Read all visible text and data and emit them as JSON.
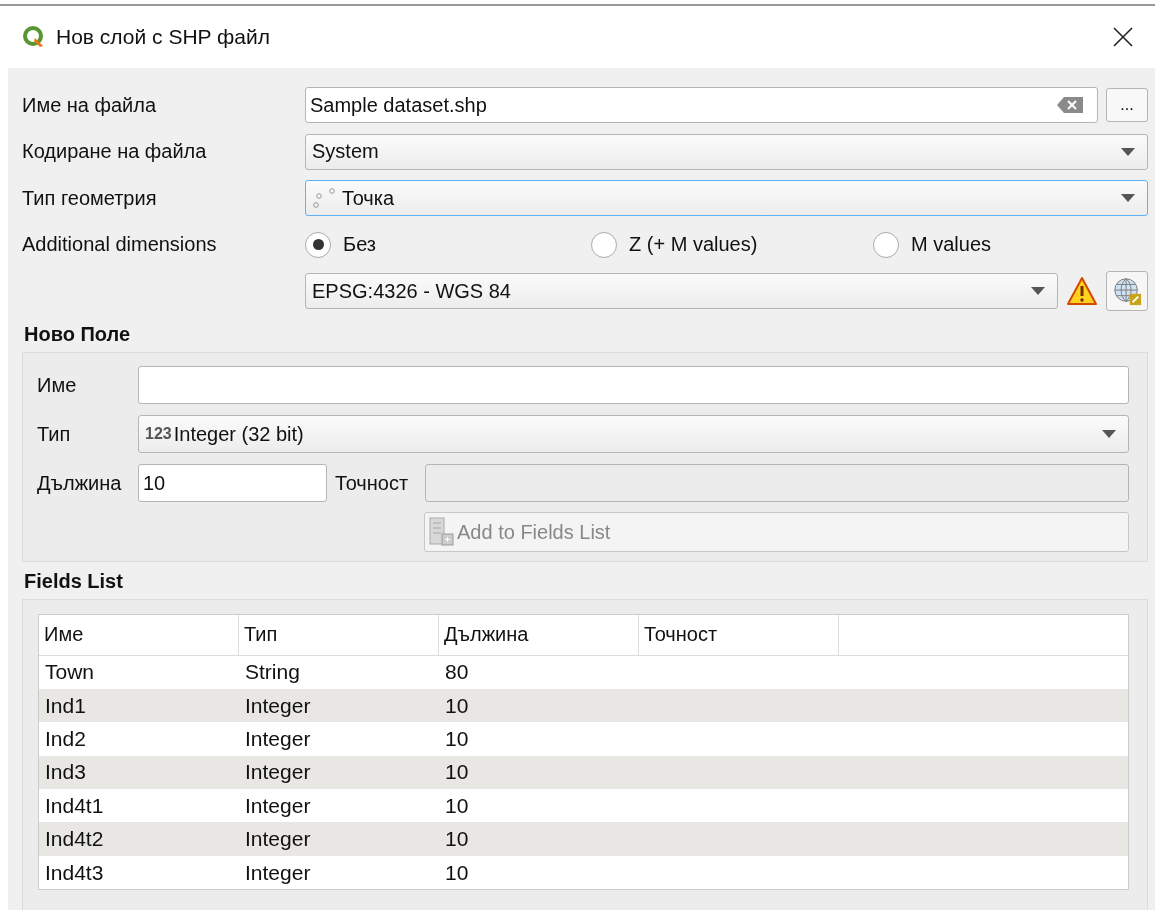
{
  "window": {
    "title": "Нов слой с SHP файл"
  },
  "file_name": {
    "label": "Име на файла",
    "value": "Sample dataset.shp",
    "browse": "..."
  },
  "file_encoding": {
    "label": "Кодиране на файла",
    "value": "System"
  },
  "geometry_type": {
    "label": "Тип геометрия",
    "value": "Точка",
    "focused": true
  },
  "dimensions": {
    "label": "Additional dimensions",
    "options": [
      {
        "label": "Без",
        "selected": true
      },
      {
        "label": "Z (+ M values)",
        "selected": false
      },
      {
        "label": "M values",
        "selected": false
      }
    ]
  },
  "crs": {
    "value": "EPSG:4326 - WGS 84"
  },
  "new_field": {
    "title": "Ново Поле",
    "name": {
      "label": "Име"
    },
    "type": {
      "label": "Тип",
      "badge": "123",
      "value": "Integer (32 bit)"
    },
    "length": {
      "label": "Дължина",
      "value": "10"
    },
    "precision": {
      "label": "Точност",
      "disabled": true
    },
    "add_button": {
      "label": "Add to Fields List",
      "disabled": true
    }
  },
  "fields_list": {
    "title": "Fields List",
    "columns": [
      "Име",
      "Тип",
      "Дължина",
      "Точност"
    ],
    "rows": [
      [
        "Town",
        "String",
        "80"
      ],
      [
        "Ind1",
        "Integer",
        "10"
      ],
      [
        "Ind2",
        "Integer",
        "10"
      ],
      [
        "Ind3",
        "Integer",
        "10"
      ],
      [
        "Ind4t1",
        "Integer",
        "10"
      ],
      [
        "Ind4t2",
        "Integer",
        "10"
      ],
      [
        "Ind4t3",
        "Integer",
        "10"
      ]
    ]
  }
}
